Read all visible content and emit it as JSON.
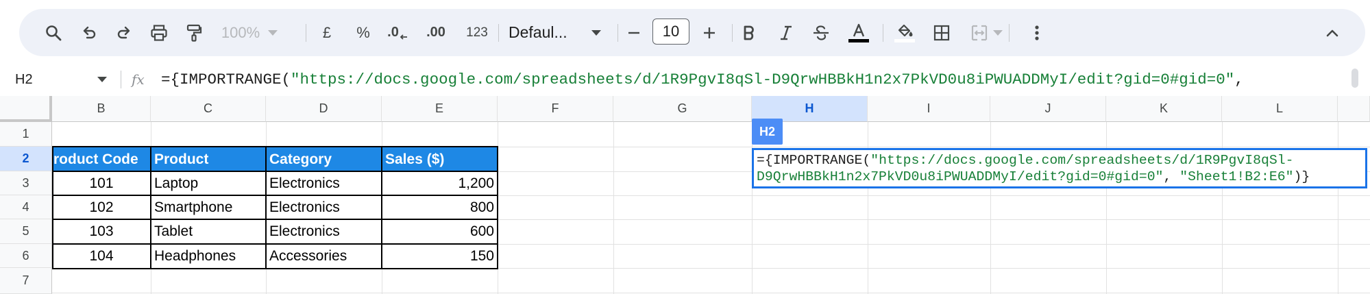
{
  "toolbar": {
    "zoom": "100%",
    "currency": "£",
    "percent": "%",
    "decrease_decimal": ".0",
    "increase_decimal": ".00",
    "number_format": "123",
    "font": "Defaul...",
    "font_size": "10"
  },
  "formula_bar": {
    "name_box": "H2",
    "fx": "fx",
    "formula_start": "={IMPORTRANGE(",
    "formula_url": "\"https://docs.google.com/spreadsheets/d/1R9PgvI8qSl-D9QrwHBBkH1n2x7PkVD0u8iPWUADDMyI/edit?gid=0#gid=0\"",
    "formula_tail": ","
  },
  "grid": {
    "columns": [
      "B",
      "C",
      "D",
      "E",
      "F",
      "G",
      "H",
      "I",
      "J",
      "K",
      "L"
    ],
    "rows": [
      "1",
      "2",
      "3",
      "4",
      "5",
      "6",
      "7"
    ],
    "headers": [
      "roduct Code",
      "Product",
      "Category",
      "Sales ($)"
    ],
    "data": [
      [
        "101",
        "Laptop",
        "Electronics",
        "1,200"
      ],
      [
        "102",
        "Smartphone",
        "Electronics",
        "800"
      ],
      [
        "103",
        "Tablet",
        "Electronics",
        "600"
      ],
      [
        "104",
        "Headphones",
        "Accessories",
        "150"
      ]
    ]
  },
  "active_cell": {
    "tag": "H2",
    "line1_a": "={IMPORTRANGE(",
    "line1_b": "\"https://docs.google.com/spreadsheets/d/1R9PgvI8qSl-",
    "line2_a": "D9QrwHBBkH1n2x7PkVD0u8iPWUADDMyI/edit?gid=0#gid=0\"",
    "line2_b": ", ",
    "line2_c": "\"Sheet1!B2:E6\"",
    "line2_d": ")}"
  }
}
